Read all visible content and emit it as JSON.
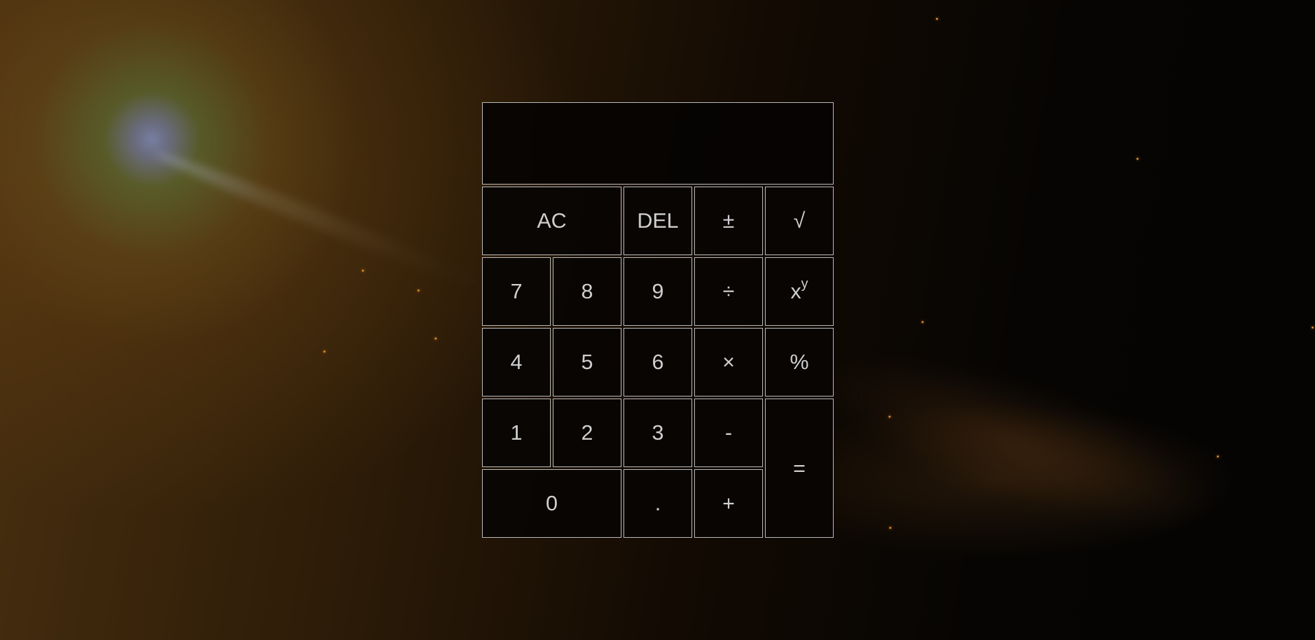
{
  "display": {
    "value": ""
  },
  "keys": {
    "ac": "AC",
    "del": "DEL",
    "plus_minus": "±",
    "sqrt": "√",
    "seven": "7",
    "eight": "8",
    "nine": "9",
    "divide": "÷",
    "power_base": "x",
    "power_exp": "y",
    "four": "4",
    "five": "5",
    "six": "6",
    "multiply": "×",
    "percent": "%",
    "one": "1",
    "two": "2",
    "three": "3",
    "minus": "-",
    "equals": "=",
    "zero": "0",
    "decimal": ".",
    "plus": "+"
  },
  "colors": {
    "key_border": "#bdbdbd",
    "key_text": "#cfcfcf",
    "key_background": "#080503",
    "star": "#d88a2a"
  }
}
